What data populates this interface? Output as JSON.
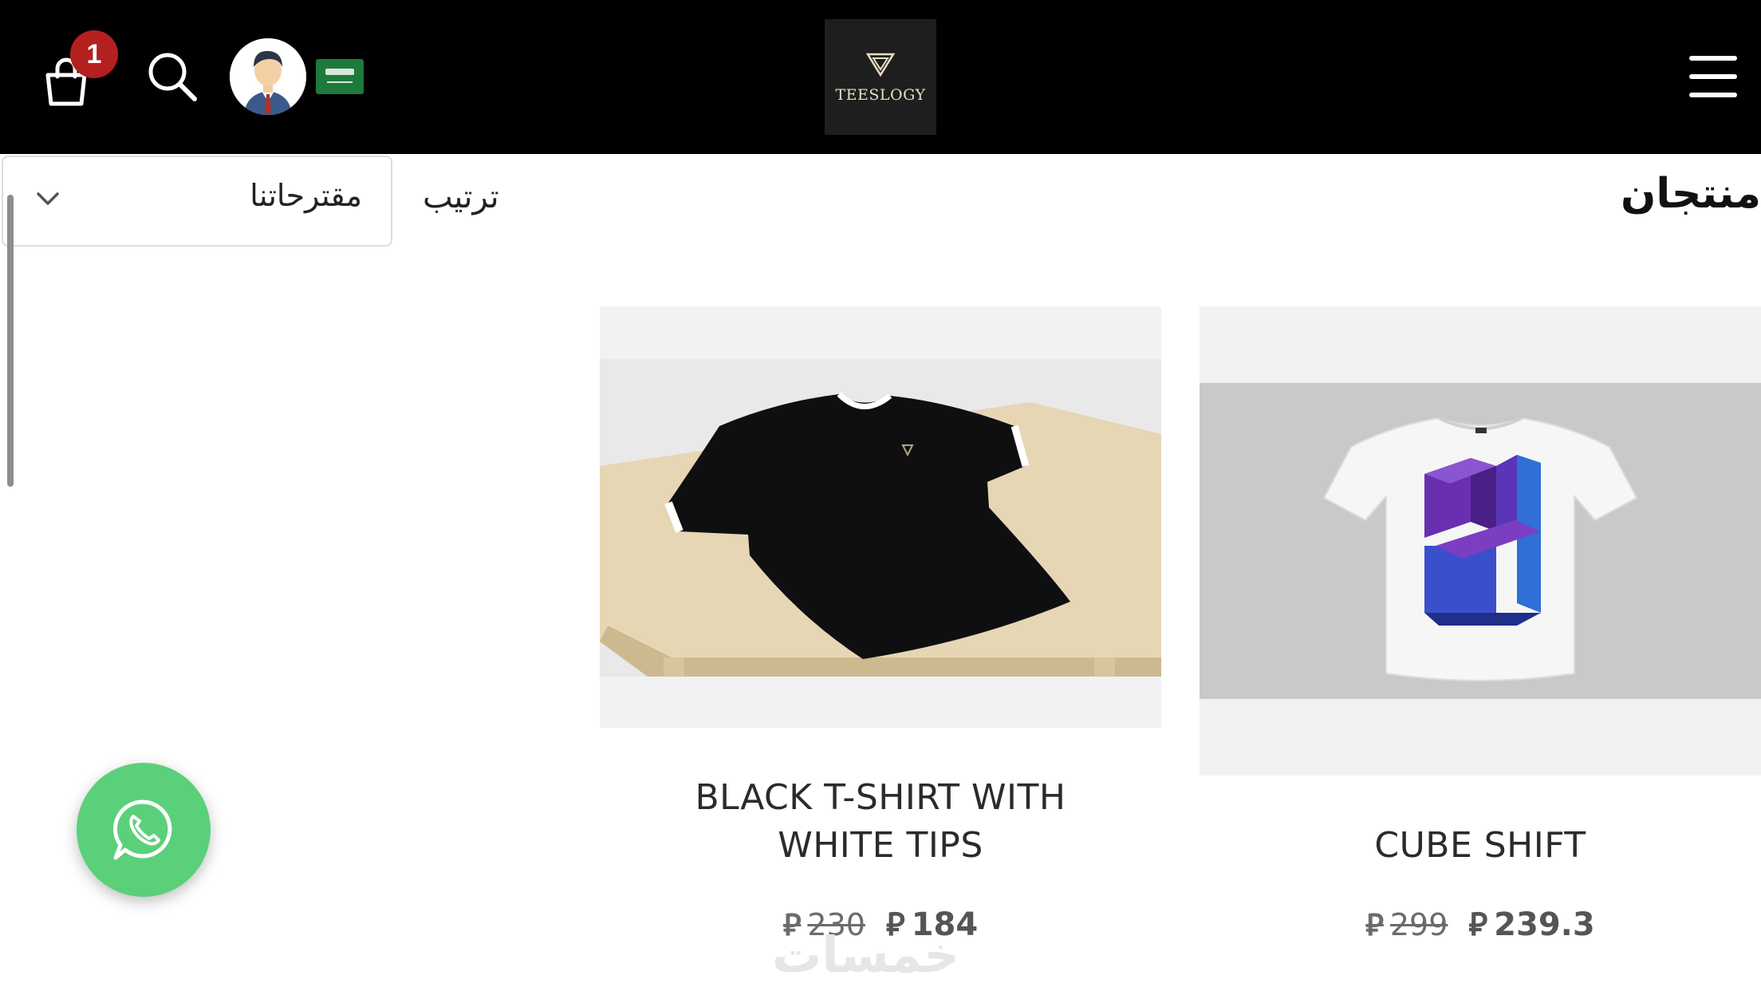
{
  "header": {
    "cart_count": "1",
    "logo_text": "TEESLOGY",
    "icons": [
      "shopping-bag-icon",
      "search-icon",
      "avatar",
      "saudi-flag-icon",
      "hamburger-menu-icon"
    ]
  },
  "page": {
    "title": "منتجان",
    "sort_label": "ترتيب",
    "sort_selected": "مقترحاتنا"
  },
  "products": [
    {
      "title_line1": "CUBE SHIFT",
      "price_old": "299",
      "price_new": "239.3",
      "currency_symbol": "⃁"
    },
    {
      "title_line1": "BLACK T-SHIRT WITH",
      "title_line2": "WHITE TIPS",
      "price_old": "230",
      "price_new": "184",
      "currency_symbol": "⃁"
    }
  ],
  "floating": {
    "whatsapp": "whatsapp-icon"
  },
  "watermark": "خمسات",
  "colors": {
    "header_bg": "#000000",
    "badge": "#b3201f",
    "whatsapp": "#5bd07a"
  }
}
